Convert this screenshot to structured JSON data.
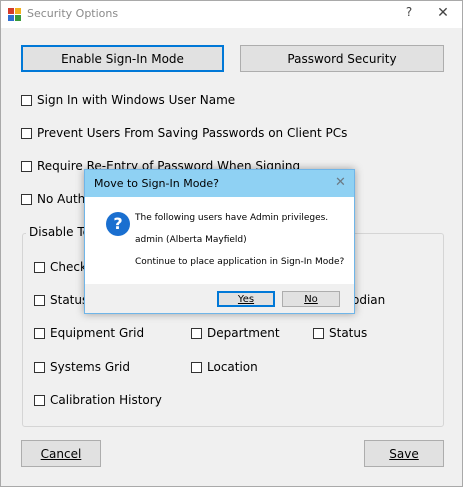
{
  "window": {
    "title": "Security Options",
    "help_glyph": "?",
    "close_glyph": "✕"
  },
  "buttons": {
    "enable_sign_in": "Enable Sign-In Mode",
    "password_security": "Password Security",
    "cancel": "Cancel",
    "save": "Save"
  },
  "options": [
    "Sign In with Windows User Name",
    "Prevent Users From Saving Passwords on Client PCs",
    "Require Re-Entry of Password When Signing",
    "No Authen"
  ],
  "group": {
    "label": "Disable Ter",
    "items": {
      "check": "Check",
      "status_left": "Status",
      "custodian_fragment": "odian",
      "equipment_grid": "Equipment Grid",
      "department": "Department",
      "status_right": "Status",
      "systems_grid": "Systems Grid",
      "location": "Location",
      "calibration_history": "Calibration History"
    }
  },
  "dialog": {
    "title": "Move to Sign-In Mode?",
    "close_glyph": "✕",
    "icon_glyph": "?",
    "line1": "The following users have Admin privileges.",
    "line2": "admin (Alberta Mayfield)",
    "line3": "Continue to place application in Sign-In Mode?",
    "yes": "Yes",
    "no": "No"
  }
}
